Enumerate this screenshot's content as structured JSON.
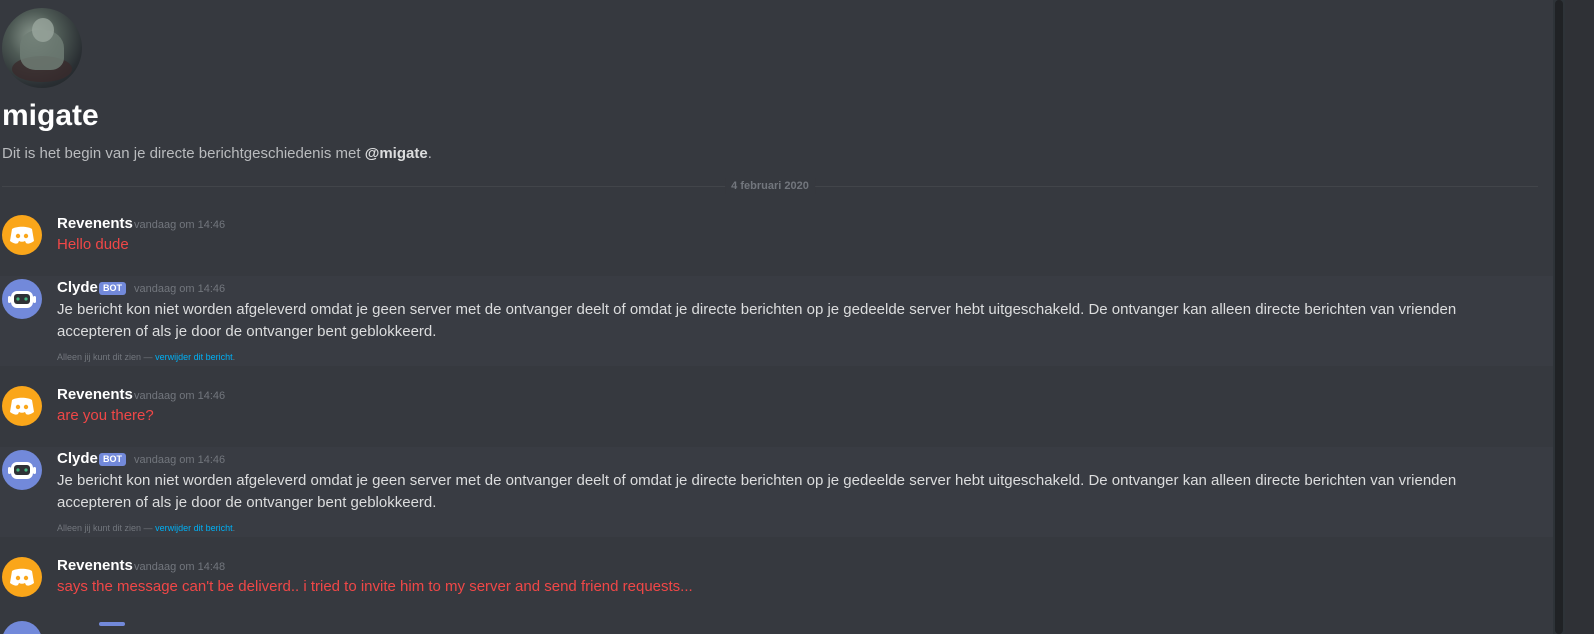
{
  "dm": {
    "name": "migate",
    "intro_prefix": "Dit is het begin van je directe berichtgeschiedenis met ",
    "intro_mention": "@migate",
    "intro_suffix": "."
  },
  "divider_date": "4 februari 2020",
  "bot_tag": "BOT",
  "ephemeral": {
    "prefix": "Alleen jij kunt dit zien —",
    "link": "verwijder dit bericht",
    "suffix": "."
  },
  "messages": [
    {
      "author": "Revenents",
      "timestamp": "vandaag om 14:46",
      "text": "Hello dude"
    },
    {
      "author": "Clyde",
      "timestamp": "vandaag om 14:46",
      "text": "Je bericht kon niet worden afgeleverd omdat je geen server met de ontvanger deelt of omdat je directe berichten op je gedeelde server hebt uitgeschakeld. De ontvanger kan alleen directe berichten van vrienden accepteren of als je door de ontvanger bent geblokkeerd."
    },
    {
      "author": "Revenents",
      "timestamp": "vandaag om 14:46",
      "text": "are you there?"
    },
    {
      "author": "Clyde",
      "timestamp": "vandaag om 14:46",
      "text": "Je bericht kon niet worden afgeleverd omdat je geen server met de ontvanger deelt of omdat je directe berichten op je gedeelde server hebt uitgeschakeld. De ontvanger kan alleen directe berichten van vrienden accepteren of als je door de ontvanger bent geblokkeerd."
    },
    {
      "author": "Revenents",
      "timestamp": "vandaag om 14:48",
      "text": "says the message can't be deliverd.. i tried to invite him to my server and send friend requests..."
    }
  ],
  "colors": {
    "background": "#36393f",
    "user_avatar": "#faa61a",
    "bot_avatar": "#7289da",
    "error_text": "#f04747",
    "link": "#00b0f4"
  },
  "icons": {
    "user_avatar": "discord-logo-icon",
    "bot_avatar": "clyde-robot-icon"
  }
}
